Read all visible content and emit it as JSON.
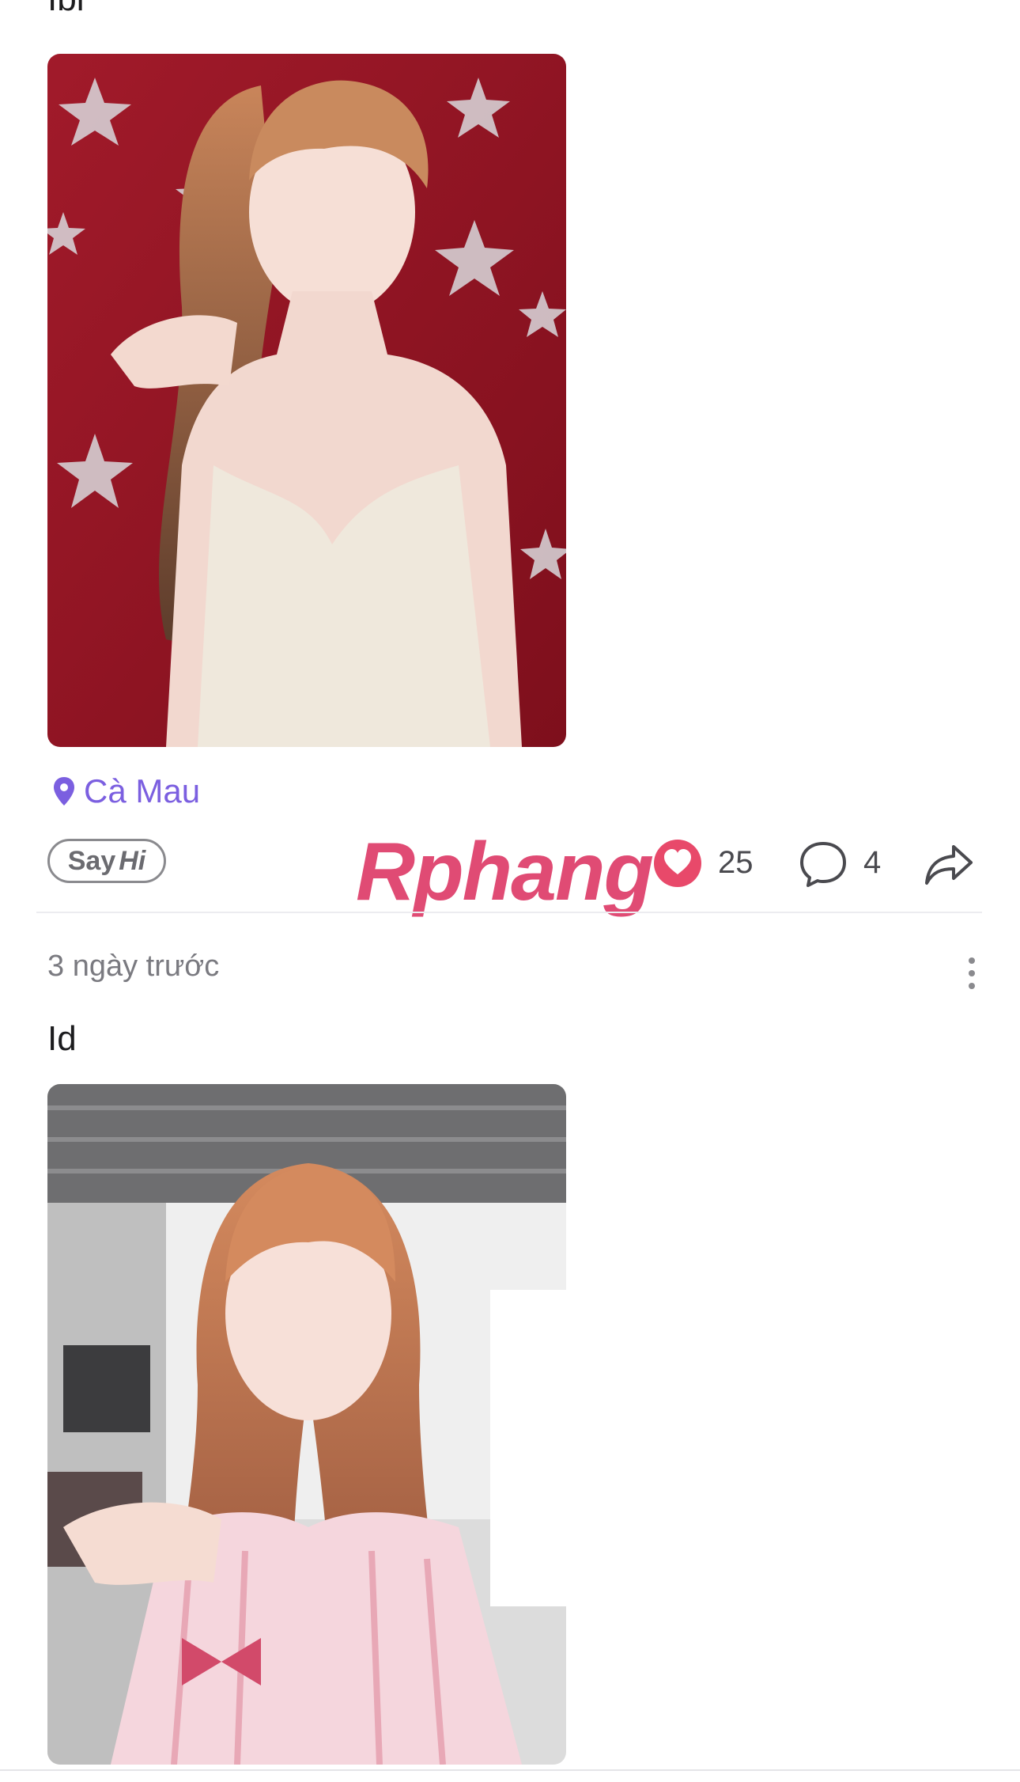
{
  "post1": {
    "caption": "Ibi",
    "location": "Cà Mau",
    "say_hi_prefix": "Say",
    "say_hi_suffix": "Hi",
    "likes": "25",
    "comments": "4"
  },
  "watermark": {
    "text_part1": "Rphang",
    "text_part2": ""
  },
  "post2": {
    "time_ago": "3 ngày trước",
    "caption": "Id"
  },
  "icons": {
    "location": "location-pin-icon",
    "like": "heart-icon",
    "comment": "comment-bubble-icon",
    "share": "share-arrow-icon",
    "more": "more-vertical-icon"
  },
  "colors": {
    "accent_purple": "#7b5fe0",
    "heart_pink": "#e8496a",
    "text_gray": "#7a7a80"
  }
}
